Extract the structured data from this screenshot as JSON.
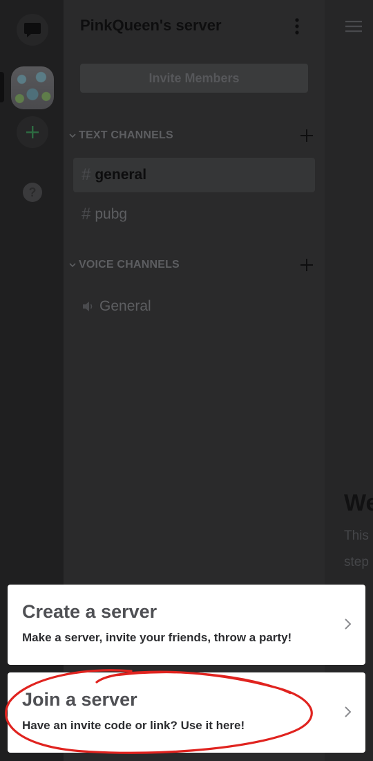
{
  "server": {
    "name": "PinkQueen's server",
    "invite_label": "Invite Members"
  },
  "rail": {
    "help_glyph": "?"
  },
  "categories": [
    {
      "label": "TEXT CHANNELS"
    },
    {
      "label": "VOICE CHANNELS"
    }
  ],
  "text_channels": [
    {
      "prefix": "#",
      "name": "general",
      "active": true
    },
    {
      "prefix": "#",
      "name": "pubg",
      "active": false
    }
  ],
  "voice_channels": [
    {
      "name": "General"
    }
  ],
  "chat_peek": {
    "heading": "We",
    "line1": "This",
    "line2": "step"
  },
  "sheet": {
    "options": [
      {
        "title": "Create a server",
        "description": "Make a server, invite your friends, throw a party!"
      },
      {
        "title": "Join a server",
        "description": "Have an invite code or link? Use it here!"
      }
    ]
  },
  "colors": {
    "accent_green": "#3ba55c",
    "annotation_red": "#e0231f"
  }
}
